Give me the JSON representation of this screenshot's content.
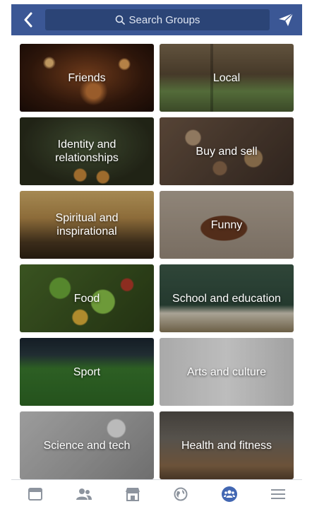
{
  "header": {
    "search_placeholder": "Search Groups"
  },
  "categories": [
    {
      "label": "Friends"
    },
    {
      "label": "Local"
    },
    {
      "label": "Identity and relationships"
    },
    {
      "label": "Buy and sell"
    },
    {
      "label": "Spiritual and inspirational"
    },
    {
      "label": "Funny"
    },
    {
      "label": "Food"
    },
    {
      "label": "School and education"
    },
    {
      "label": "Sport"
    },
    {
      "label": "Arts and culture"
    },
    {
      "label": "Science and tech"
    },
    {
      "label": "Health and fitness"
    }
  ],
  "tabbar": {
    "items": [
      {
        "icon": "news-feed-icon",
        "active": false
      },
      {
        "icon": "friends-icon",
        "active": false
      },
      {
        "icon": "marketplace-icon",
        "active": false
      },
      {
        "icon": "notifications-globe-icon",
        "active": false
      },
      {
        "icon": "groups-icon",
        "active": true
      },
      {
        "icon": "menu-icon",
        "active": false
      }
    ]
  },
  "colors": {
    "brand": "#3b5795",
    "search_bg": "#2b4476",
    "active_tab": "#4267b2",
    "inactive_tab": "#8d949e"
  }
}
